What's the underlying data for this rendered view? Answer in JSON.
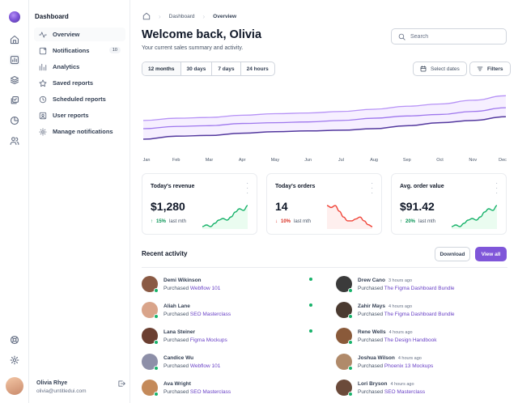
{
  "colors": {
    "brand": "#7f56d9",
    "brand_light": "#b692f6",
    "success": "#17b26a",
    "error": "#f04438",
    "border": "#eaecf0"
  },
  "rail": {
    "icons": [
      "home-icon",
      "bar-chart-icon",
      "layers-icon",
      "check-square-icon",
      "pie-chart-icon",
      "users-icon",
      "support-icon",
      "settings-icon"
    ]
  },
  "sidebar": {
    "title": "Dashboard",
    "items": [
      {
        "label": "Overview",
        "icon": "activity-icon",
        "active": true
      },
      {
        "label": "Notifications",
        "icon": "notification-icon",
        "badge": "10"
      },
      {
        "label": "Analytics",
        "icon": "analytics-icon"
      },
      {
        "label": "Saved reports",
        "icon": "star-icon"
      },
      {
        "label": "Scheduled reports",
        "icon": "clock-icon"
      },
      {
        "label": "User reports",
        "icon": "user-square-icon"
      },
      {
        "label": "Manage notifications",
        "icon": "settings-icon"
      }
    ],
    "user": {
      "name": "Olivia Rhye",
      "email": "olivia@untitledui.com"
    }
  },
  "breadcrumb": {
    "items": [
      "Dashboard",
      "Overview"
    ]
  },
  "header": {
    "title": "Welcome back, Olivia",
    "subtitle": "Your current sales summary and activity."
  },
  "search": {
    "placeholder": "Search"
  },
  "range_tabs": [
    "12 months",
    "30 days",
    "7 days",
    "24 hours"
  ],
  "actions": {
    "select_dates": "Select dates",
    "filters": "Filters"
  },
  "chart_data": {
    "type": "line",
    "categories": [
      "Jan",
      "Feb",
      "Mar",
      "Apr",
      "May",
      "Jun",
      "Jul",
      "Aug",
      "Sep",
      "Oct",
      "Nov",
      "Dec"
    ],
    "series": [
      {
        "values": [
          38,
          41,
          42,
          45,
          47,
          48,
          50,
          53,
          57,
          60,
          65,
          71
        ]
      },
      {
        "values": [
          27,
          30,
          31,
          34,
          35,
          36,
          38,
          41,
          44,
          46,
          50,
          55
        ]
      },
      {
        "values": [
          13,
          17,
          18,
          21,
          23,
          24,
          25,
          27,
          31,
          35,
          38,
          43
        ]
      }
    ],
    "ylim": [
      0,
      80
    ],
    "grid": false
  },
  "cards": [
    {
      "title": "Today's revenue",
      "value": "$1,280",
      "delta": "15%",
      "delta_dir": "up",
      "period": "last mth",
      "trend": [
        2,
        3,
        2,
        4,
        6,
        7,
        6,
        8,
        11,
        13,
        12,
        15
      ]
    },
    {
      "title": "Today's orders",
      "value": "14",
      "delta": "10%",
      "delta_dir": "down",
      "period": "last mth",
      "trend": [
        14,
        13,
        14,
        11,
        8,
        6,
        6,
        7,
        8,
        6,
        4,
        3
      ]
    },
    {
      "title": "Avg. order value",
      "value": "$91.42",
      "delta": "20%",
      "delta_dir": "up",
      "period": "last mth",
      "trend": [
        2,
        3,
        2,
        4,
        6,
        7,
        6,
        8,
        11,
        13,
        12,
        15
      ]
    }
  ],
  "recent": {
    "title": "Recent activity",
    "download": "Download",
    "view_all": "View all",
    "left": [
      {
        "name": "Demi Wikinson",
        "verb": "Purchased",
        "item": "Webflow 101",
        "avatar": "#8a5a44"
      },
      {
        "name": "Aliah Lane",
        "verb": "Purchased",
        "item": "SEO Masterclass",
        "avatar": "#d9a48a"
      },
      {
        "name": "Lana Steiner",
        "verb": "Purchased",
        "item": "Figma Mockups",
        "avatar": "#6b3f31"
      },
      {
        "name": "Candice Wu",
        "verb": "Purchased",
        "item": "Webflow 101",
        "avatar": "#8d8fa8"
      },
      {
        "name": "Ava Wright",
        "verb": "Purchased",
        "item": "SEO Masterclass",
        "avatar": "#c48a5a"
      }
    ],
    "right": [
      {
        "name": "Drew Cano",
        "time": "3 hours ago",
        "verb": "Purchased",
        "item": "The Figma Dashboard Bundle",
        "avatar": "#3b3b3b"
      },
      {
        "name": "Zahir Mays",
        "time": "4 hours ago",
        "verb": "Purchased",
        "item": "The Figma Dashboard Bundle",
        "avatar": "#4a3a30"
      },
      {
        "name": "Rene Wells",
        "time": "4 hours ago",
        "verb": "Purchased",
        "item": "The Design Handbook",
        "avatar": "#8a5a3a"
      },
      {
        "name": "Joshua Wilson",
        "time": "4 hours ago",
        "verb": "Purchased",
        "item": "Phoenix 13 Mockups",
        "avatar": "#b08a6a"
      },
      {
        "name": "Lori Bryson",
        "time": "4 hours ago",
        "verb": "Purchased",
        "item": "SEO Masterclass",
        "avatar": "#6b4a3a"
      }
    ]
  }
}
